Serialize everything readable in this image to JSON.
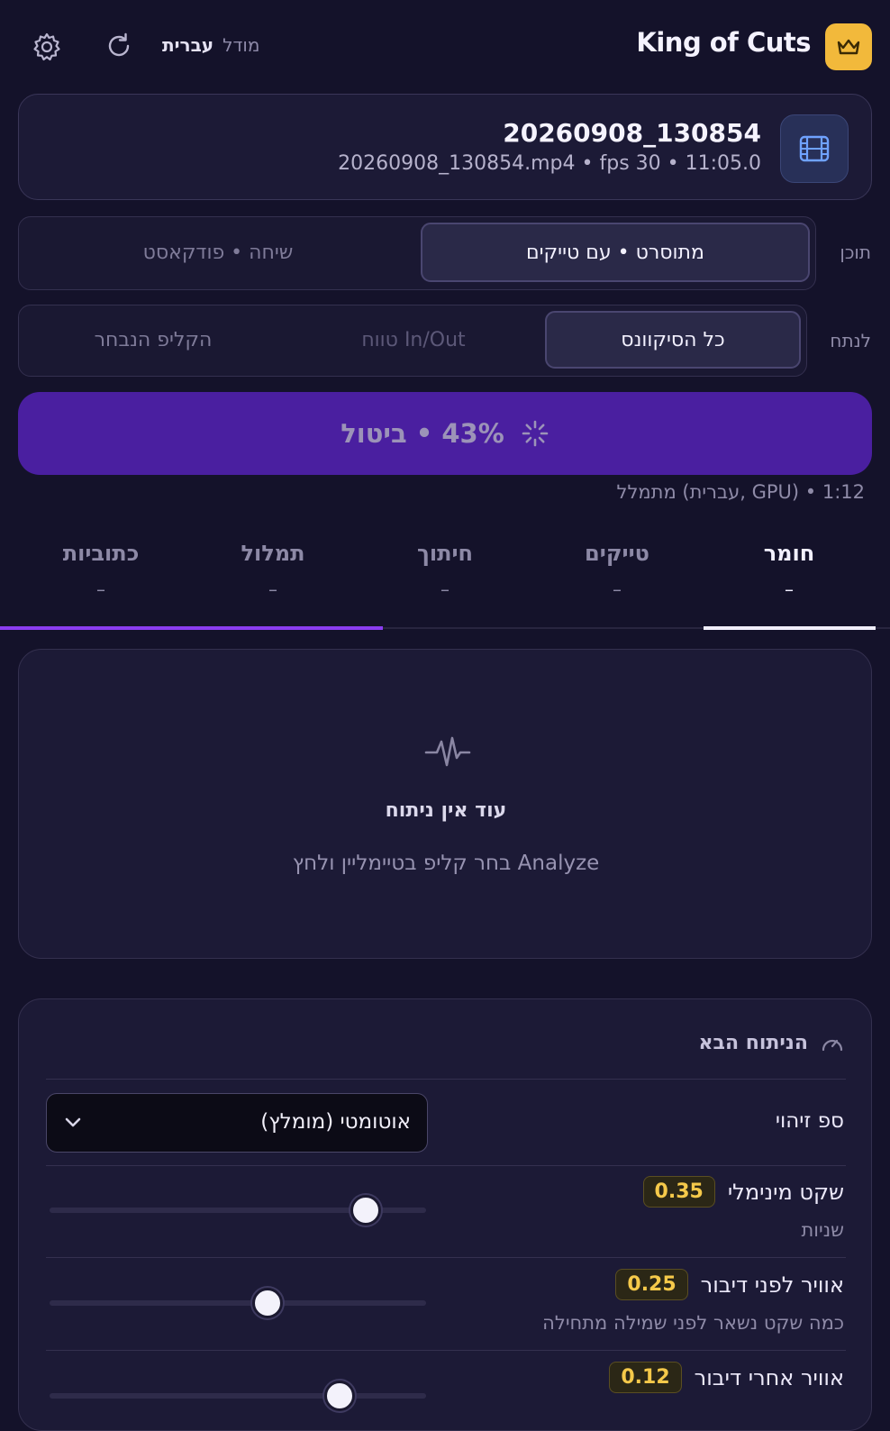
{
  "header": {
    "brand": "King of Cuts",
    "model_label": "מודל",
    "model_value": "עברית",
    "icons": [
      "crown-icon",
      "settings-gear-icon",
      "refresh-icon"
    ]
  },
  "file": {
    "name": "20260908_130854",
    "meta": "20260908_130854.mp4 • fps 30 • 11:05.0",
    "icon": "film-icon"
  },
  "content_row": {
    "label": "תוכן",
    "options": [
      "מתוסרט • עם טייקים",
      "שיחה • פודקאסט"
    ],
    "selected": "מתוסרט • עם טייקים"
  },
  "analyze_row": {
    "label": "לנתח",
    "options": [
      "כל הסיקוונס",
      "טווח In/Out",
      "הקליפ הנבחר"
    ],
    "selected": "כל הסיקוונס"
  },
  "progress": {
    "text": "43% • ביטול",
    "percent": 43,
    "status": "מתמלל (עברית, GPU) • 1:12"
  },
  "tabs": [
    {
      "label": "חומר",
      "count": "–",
      "active": true
    },
    {
      "label": "טייקים",
      "count": "–",
      "active": false
    },
    {
      "label": "חיתוך",
      "count": "–",
      "active": false
    },
    {
      "label": "תמלול",
      "count": "–",
      "active": false
    },
    {
      "label": "כתוביות",
      "count": "–",
      "active": false
    }
  ],
  "empty_state": {
    "title": "עוד אין ניתוח",
    "subtitle": "בחר קליפ בטיימליין ולחץ Analyze"
  },
  "next_analysis": {
    "title": "הניתוח הבא",
    "detection_threshold": {
      "label": "ספ זיהוי",
      "value": "אוטומטי (מומלץ)"
    },
    "sliders": [
      {
        "label": "שקט מינימלי",
        "value": "0.35",
        "hint": "שניות",
        "fraction": 0.84
      },
      {
        "label": "אוויר לפני דיבור",
        "value": "0.25",
        "hint": "כמה שקט נשאר לפני שמילה מתחילה",
        "fraction": 0.58
      },
      {
        "label": "אוויר אחרי דיבור",
        "value": "0.12",
        "hint": "",
        "fraction": 0.77
      }
    ]
  },
  "colors": {
    "background": "#14122a",
    "accent_purple": "#4a1fa0",
    "progress_bar": "#8b3df0",
    "brand_gold": "#f2b93b",
    "badge_text": "#f5c94a"
  }
}
